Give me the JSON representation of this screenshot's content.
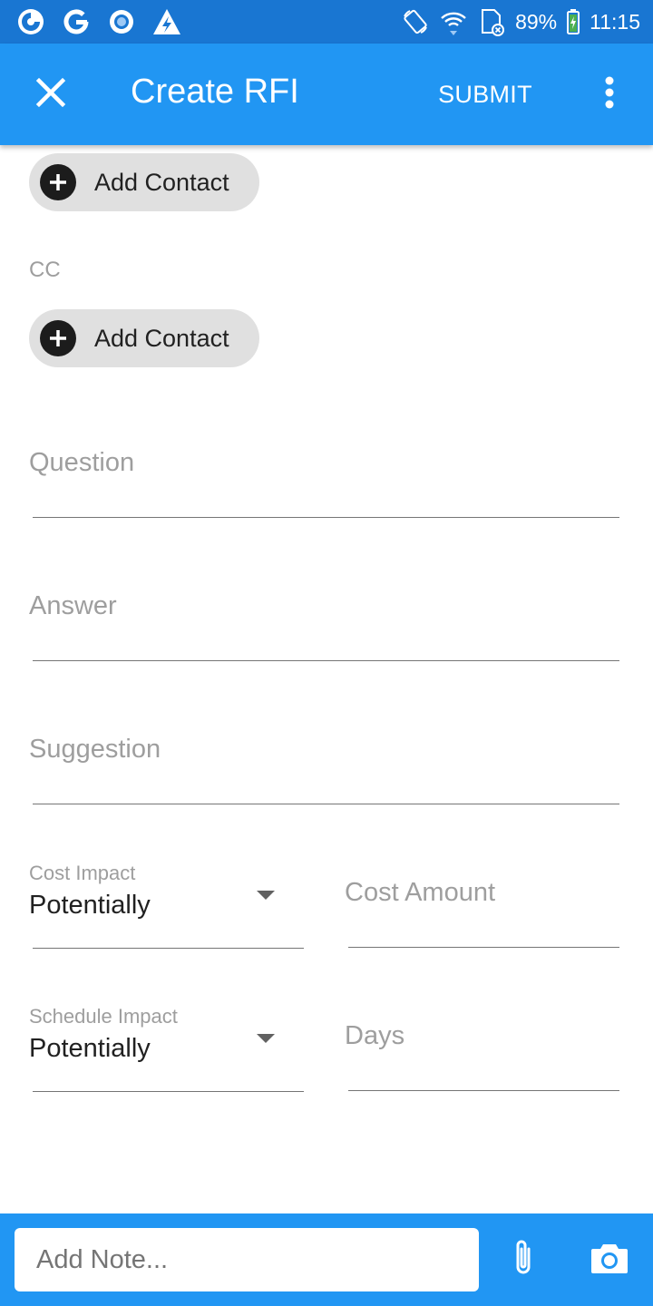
{
  "status_bar": {
    "battery": "89%",
    "time": "11:15",
    "left_icons": [
      "app-logo-icon",
      "google-g-icon",
      "circle-app-icon",
      "zap-app-icon"
    ],
    "right_icons": [
      "auto-rotate-icon",
      "wifi-icon",
      "sim-card-icon",
      "battery-charging-icon"
    ]
  },
  "app_bar": {
    "title": "Create RFI",
    "submit_label": "SUBMIT",
    "close_icon": "close-icon",
    "more_icon": "more-vertical-icon"
  },
  "to": {
    "add_contact_label": "Add Contact"
  },
  "cc": {
    "label": "CC",
    "add_contact_label": "Add Contact"
  },
  "fields": {
    "question": {
      "placeholder": "Question",
      "value": ""
    },
    "answer": {
      "placeholder": "Answer",
      "value": ""
    },
    "suggestion": {
      "placeholder": "Suggestion",
      "value": ""
    },
    "cost_impact": {
      "label": "Cost Impact",
      "value": "Potentially"
    },
    "cost_amount": {
      "placeholder": "Cost Amount",
      "value": ""
    },
    "schedule_impact": {
      "label": "Schedule Impact",
      "value": "Potentially"
    },
    "days": {
      "placeholder": "Days",
      "value": ""
    }
  },
  "bottom_bar": {
    "note_placeholder": "Add Note...",
    "attach_icon": "paperclip-icon",
    "camera_icon": "camera-icon"
  },
  "colors": {
    "status_bar": "#1976D2",
    "primary": "#2196F3",
    "chip_background": "#E0E0E0",
    "hint_text": "#9E9E9E"
  }
}
